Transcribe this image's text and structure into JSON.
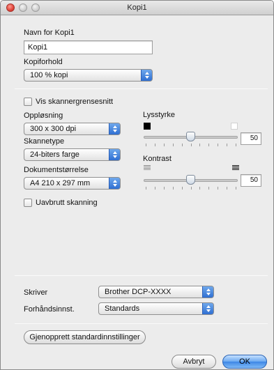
{
  "window": {
    "title": "Kopi1"
  },
  "name_section": {
    "label": "Navn for Kopi1",
    "value": "Kopi1"
  },
  "ratio_section": {
    "label": "Kopiforhold",
    "selected": "100 % kopi"
  },
  "scanner_ui": {
    "label": "Vis skannergrensesnitt",
    "checked": false
  },
  "resolution": {
    "label": "Oppløsning",
    "selected": "300 x 300 dpi"
  },
  "scan_type": {
    "label": "Skannetype",
    "selected": "24-biters farge"
  },
  "doc_size": {
    "label": "Dokumentstørrelse",
    "selected": "A4 210 x 297 mm"
  },
  "continuous_scan": {
    "label": "Uavbrutt skanning",
    "checked": false
  },
  "brightness": {
    "label": "Lysstyrke",
    "value": "50",
    "level": 50,
    "min": 0,
    "max": 100
  },
  "contrast": {
    "label": "Kontrast",
    "value": "50",
    "level": 50,
    "min": 0,
    "max": 100
  },
  "printer": {
    "label": "Skriver",
    "selected": "Brother DCP-XXXX"
  },
  "presets": {
    "label": "Forhåndsinnst.",
    "selected": "Standards"
  },
  "buttons": {
    "restore": "Gjenopprett standardinnstillinger",
    "cancel": "Avbryt",
    "ok": "OK"
  },
  "colors": {
    "accent": "#3d86e6",
    "close": "#e0443a"
  }
}
